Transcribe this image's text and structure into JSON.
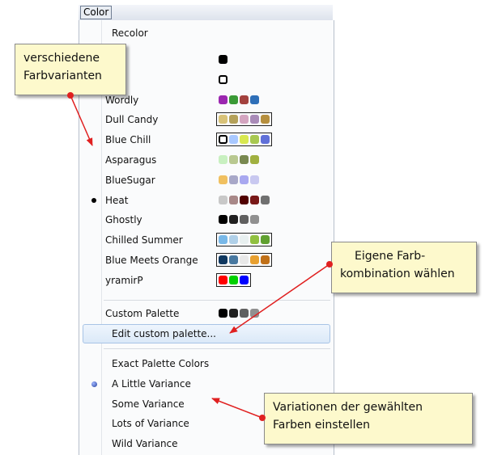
{
  "menubar": {
    "title": "Color"
  },
  "menu": {
    "recolor": "Recolor",
    "palettes": [
      {
        "label": "",
        "selected": false,
        "framed": false,
        "colors": [
          "#000000"
        ]
      },
      {
        "label": "",
        "selected": false,
        "framed": false,
        "colors": [
          "#ffffff"
        ]
      },
      {
        "label": "Wordly",
        "selected": false,
        "framed": false,
        "colors": [
          "#9b27b0",
          "#3a9a36",
          "#a3413e",
          "#2e6fb8"
        ]
      },
      {
        "label": "Dull Candy",
        "selected": false,
        "framed": true,
        "colors": [
          "#d8c278",
          "#b4a15a",
          "#d4a5c0",
          "#a98bb8",
          "#b68f3e"
        ]
      },
      {
        "label": "Blue Chill",
        "selected": false,
        "framed": true,
        "colors": [
          "#ffffff",
          "#a8c8ff",
          "#d8e850",
          "#a8c850",
          "#6070d8"
        ]
      },
      {
        "label": "Asparagus",
        "selected": false,
        "framed": false,
        "colors": [
          "#c8f0c0",
          "#b8c890",
          "#788850",
          "#a0b040"
        ]
      },
      {
        "label": "BlueSugar",
        "selected": false,
        "framed": false,
        "colors": [
          "#f0c060",
          "#a8a8c8",
          "#a8a8f0",
          "#c8c8f0"
        ]
      },
      {
        "label": "Heat",
        "selected": true,
        "framed": false,
        "colors": [
          "#c8c8c8",
          "#a88888",
          "#500000",
          "#781818",
          "#707070"
        ]
      },
      {
        "label": "Ghostly",
        "selected": false,
        "framed": false,
        "colors": [
          "#000000",
          "#202020",
          "#606060",
          "#909090"
        ]
      },
      {
        "label": "Chilled Summer",
        "selected": false,
        "framed": true,
        "colors": [
          "#78b8e8",
          "#b0d0e8",
          "#e8f0f0",
          "#90c040",
          "#60a030"
        ]
      },
      {
        "label": "Blue Meets Orange",
        "selected": false,
        "framed": true,
        "colors": [
          "#103860",
          "#4878a0",
          "#e8e8e8",
          "#e8a030",
          "#c07018"
        ]
      },
      {
        "label": "yramirP",
        "selected": false,
        "framed": true,
        "colors": [
          "#ff0000",
          "#00d000",
          "#0000ff"
        ]
      }
    ],
    "custom_palette": {
      "label": "Custom Palette",
      "colors": [
        "#000000",
        "#202020",
        "#606060",
        "#909090"
      ]
    },
    "edit_custom_palette": "Edit custom palette...",
    "variance": [
      {
        "label": "Exact Palette Colors",
        "selected": false
      },
      {
        "label": "A Little Variance",
        "selected": true
      },
      {
        "label": "Some Variance",
        "selected": false
      },
      {
        "label": "Lots of Variance",
        "selected": false
      },
      {
        "label": "Wild Variance",
        "selected": false
      }
    ]
  },
  "notes": {
    "variants": [
      "verschiedene",
      "Farbvarianten"
    ],
    "custom": [
      "Eigene Farb-",
      "kombination wählen"
    ],
    "variations": [
      "Variationen der gewählten",
      "Farben einstellen"
    ]
  },
  "colors": {
    "arrow": "#e02020",
    "note_bg": "#fdf9cc"
  }
}
